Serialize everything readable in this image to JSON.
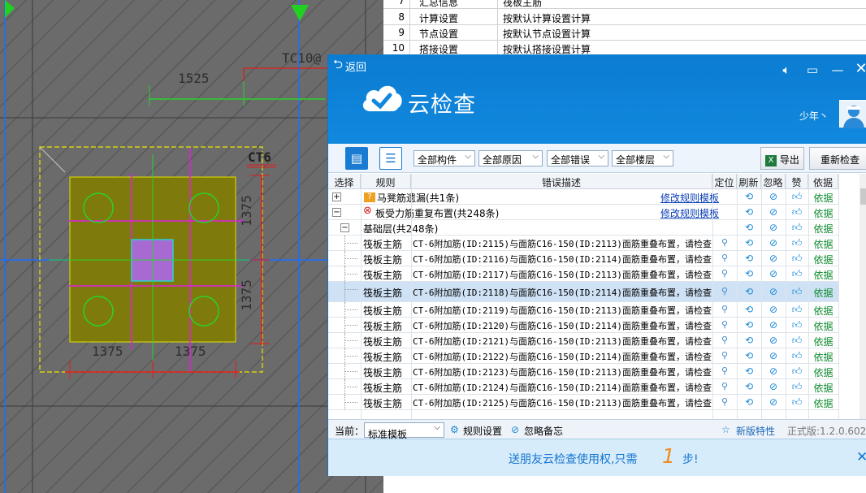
{
  "cad": {
    "dim_top": "1525",
    "dim_right_top": "1375",
    "dim_right_bottom": "1375",
    "dim_bottom_left": "1375",
    "dim_bottom_right": "1375",
    "label_ct6": "CT6",
    "label_tc": "TC10@"
  },
  "bg_table": {
    "rows": [
      {
        "num": "7",
        "name": "汇总信息",
        "value": "筏板主筋"
      },
      {
        "num": "8",
        "name": "计算设置",
        "value": "按默认计算设置计算"
      },
      {
        "num": "9",
        "name": "节点设置",
        "value": "按默认节点设置计算"
      },
      {
        "num": "10",
        "name": "搭接设置",
        "value": "按默认搭接设置计算"
      }
    ]
  },
  "dialog": {
    "back_label": "返回",
    "brand": "云检查",
    "username": "少年丶",
    "toolbar": {
      "filter_component": "全部构件",
      "filter_reason": "全部原因",
      "filter_error": "全部错误",
      "filter_floor": "全部楼层",
      "export_label": "导出",
      "recheck_label": "重新检查"
    },
    "columns": [
      "选择",
      "规则",
      "错误描述",
      "定位",
      "刷新",
      "忽略",
      "赞",
      "依据"
    ],
    "groups": [
      {
        "expand": "+",
        "title": "马凳筋遗漏(共1条)",
        "link": "修改规则模板",
        "basis": "依据"
      },
      {
        "expand": "−",
        "title": "板受力筋重复布置(共248条)",
        "link": "修改规则模板",
        "basis": "依据"
      }
    ],
    "subgroup": {
      "expand": "−",
      "title": "基础层(共248条)",
      "basis": "依据"
    },
    "rows": [
      {
        "rule": "筏板主筋",
        "desc": "CT-6附加筋(ID:2115)与面筋C16-150(ID:2113)面筋重叠布置，请检查",
        "basis": "依据"
      },
      {
        "rule": "筏板主筋",
        "desc": "CT-6附加筋(ID:2116)与面筋C16-150(ID:2114)面筋重叠布置，请检查",
        "basis": "依据"
      },
      {
        "rule": "筏板主筋",
        "desc": "CT-6附加筋(ID:2117)与面筋C16-150(ID:2113)面筋重叠布置，请检查",
        "basis": "依据"
      },
      {
        "rule": "筏板主筋",
        "desc": "CT-6附加筋(ID:2118)与面筋C16-150(ID:2114)面筋重叠布置，请检查",
        "basis": "依据",
        "selected": true
      },
      {
        "rule": "筏板主筋",
        "desc": "CT-6附加筋(ID:2119)与面筋C16-150(ID:2113)面筋重叠布置，请检查",
        "basis": "依据"
      },
      {
        "rule": "筏板主筋",
        "desc": "CT-6附加筋(ID:2120)与面筋C16-150(ID:2114)面筋重叠布置，请检查",
        "basis": "依据"
      },
      {
        "rule": "筏板主筋",
        "desc": "CT-6附加筋(ID:2121)与面筋C16-150(ID:2113)面筋重叠布置，请检查",
        "basis": "依据"
      },
      {
        "rule": "筏板主筋",
        "desc": "CT-6附加筋(ID:2122)与面筋C16-150(ID:2114)面筋重叠布置，请检查",
        "basis": "依据"
      },
      {
        "rule": "筏板主筋",
        "desc": "CT-6附加筋(ID:2123)与面筋C16-150(ID:2113)面筋重叠布置，请检查",
        "basis": "依据"
      },
      {
        "rule": "筏板主筋",
        "desc": "CT-6附加筋(ID:2124)与面筋C16-150(ID:2114)面筋重叠布置，请检查",
        "basis": "依据"
      },
      {
        "rule": "筏板主筋",
        "desc": "CT-6附加筋(ID:2125)与面筋C16-150(ID:2113)面筋重叠布置，请检查",
        "basis": "依据"
      }
    ],
    "status": {
      "current_label": "当前：",
      "template_value": "标准模板",
      "rule_settings": "规则设置",
      "ignore_notes": "忽略备忘",
      "new_features": "新版特性",
      "version": "正式版:1.2.0.602"
    },
    "promo": {
      "text": "送朋友云检查使用权,只需",
      "number": "1",
      "step": "步!"
    }
  }
}
